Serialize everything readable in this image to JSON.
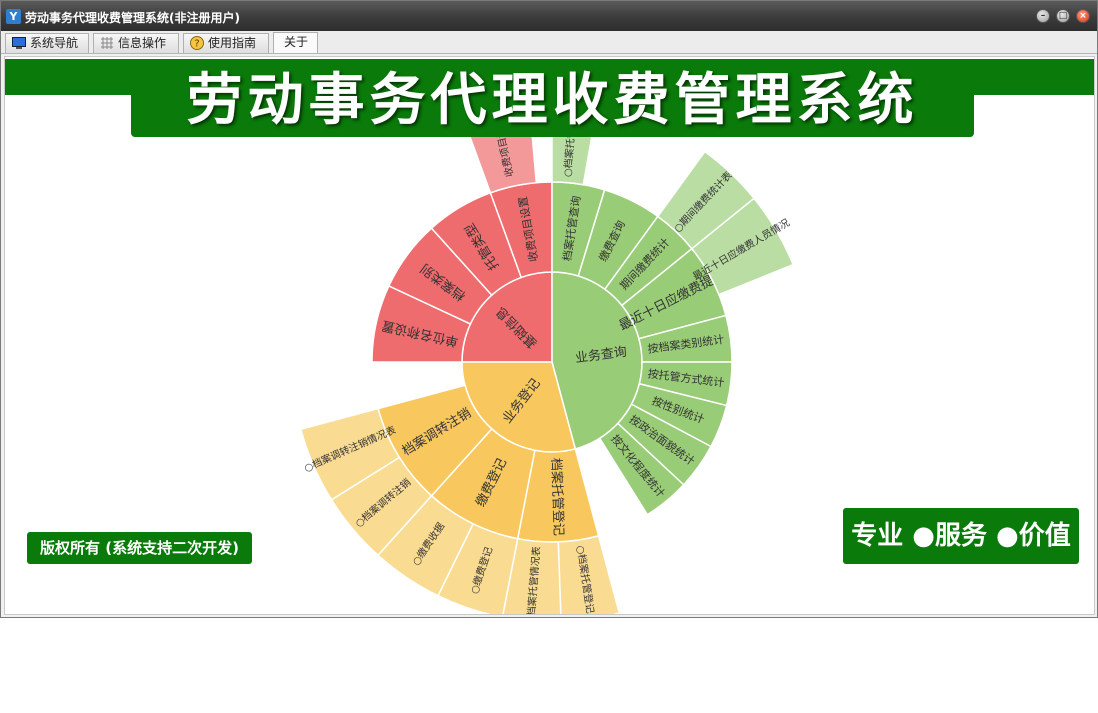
{
  "window": {
    "title": "劳动事务代理收费管理系统(非注册用户)"
  },
  "tabs": [
    {
      "label": "系统导航",
      "icon": "monitor-icon"
    },
    {
      "label": "信息操作",
      "icon": "grid-icon"
    },
    {
      "label": "使用指南",
      "icon": "help-icon"
    },
    {
      "label": "关于",
      "icon": ""
    }
  ],
  "banner": {
    "title": "劳动事务代理收费管理系统"
  },
  "footer": {
    "copyright": "版权所有 (系统支持二次开发)",
    "slogan": "专业 ●服务 ●价值"
  },
  "colors": {
    "brand_green": "#0a7a0a",
    "red": "#ee6b6e",
    "red_light": "#f3999a",
    "green": "#99cc77",
    "green_light": "#b9dda3",
    "orange": "#f8c85e",
    "orange_light": "#fadb92"
  },
  "sunburst": {
    "groups": [
      {
        "label": "基础信息",
        "color": "red",
        "children": [
          {
            "label": "单位名称设置"
          },
          {
            "label": "档案类别"
          },
          {
            "label": "托管类型"
          },
          {
            "label": "收费项目设置",
            "children": [
              {
                "label": "收费项目设置"
              }
            ]
          }
        ]
      },
      {
        "label": "业务查询",
        "color": "green",
        "children": [
          {
            "label": "档案托管查询",
            "children": [
              {
                "label": "○档案托管查询"
              }
            ]
          },
          {
            "label": "缴费查询"
          },
          {
            "label": "期间缴费统计",
            "children": [
              {
                "label": "○期间缴费统计表"
              }
            ]
          },
          {
            "label": "最近十日应缴费提醒",
            "children": [
              {
                "label": "最近十日应缴费人员情况"
              }
            ]
          },
          {
            "label": "按档案类别统计"
          },
          {
            "label": "按托管方式统计"
          },
          {
            "label": "按性别统计"
          },
          {
            "label": "按政治面貌统计"
          },
          {
            "label": "按文化程度统计"
          }
        ]
      },
      {
        "label": "业务登记",
        "color": "orange",
        "children": [
          {
            "label": "档案托管登记",
            "children": [
              {
                "label": "○档案托管登记"
              },
              {
                "label": "档案托管情况表"
              }
            ]
          },
          {
            "label": "缴费登记",
            "children": [
              {
                "label": "○缴费登记"
              },
              {
                "label": "○缴费收据"
              }
            ]
          },
          {
            "label": "档案调转注销",
            "children": [
              {
                "label": "○档案调转注销"
              },
              {
                "label": "○档案调转注销情况表"
              }
            ]
          }
        ]
      }
    ]
  }
}
